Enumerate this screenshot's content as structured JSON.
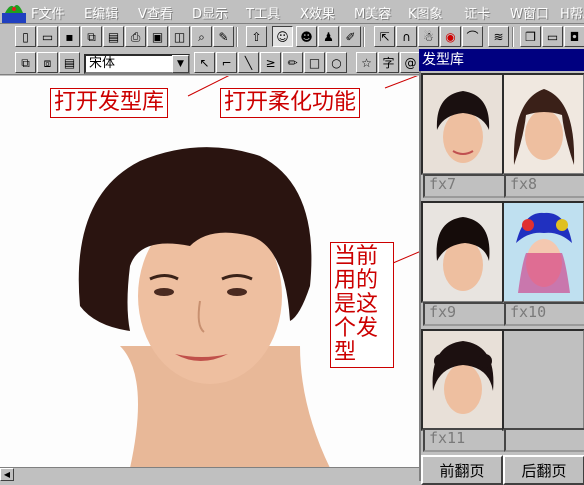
{
  "menu": {
    "items": [
      {
        "key": "F",
        "label": "文件"
      },
      {
        "key": "E",
        "label": "编辑"
      },
      {
        "key": "V",
        "label": "查看"
      },
      {
        "key": "D",
        "label": "显示"
      },
      {
        "key": "T",
        "label": "工具"
      },
      {
        "key": "X",
        "label": "效果"
      },
      {
        "key": "M",
        "label": "美容"
      },
      {
        "key": "K",
        "label": "图象"
      },
      {
        "key": "",
        "label": "证卡"
      },
      {
        "key": "W",
        "label": "窗口"
      },
      {
        "key": "H",
        "label": "帮助"
      }
    ]
  },
  "toolbar2": {
    "font_value": "宋体",
    "text_tool_glyph": "字"
  },
  "callouts": {
    "open_hairstyle_library": "打开发型库",
    "open_softening": "打开柔化功能",
    "current_hairstyle": [
      "当前",
      "用的",
      "是这",
      "个发",
      "型"
    ]
  },
  "panel": {
    "title": "发型库",
    "thumbnails": [
      {
        "label": "fx7"
      },
      {
        "label": "fx8"
      },
      {
        "label": "fx9"
      },
      {
        "label": "fx10"
      },
      {
        "label": "fx11"
      },
      {
        "label": ""
      }
    ],
    "prev_label": "前翻页",
    "next_label": "后翻页"
  },
  "colors": {
    "callout_red": "#cc0000",
    "title_bar": "#000080"
  }
}
